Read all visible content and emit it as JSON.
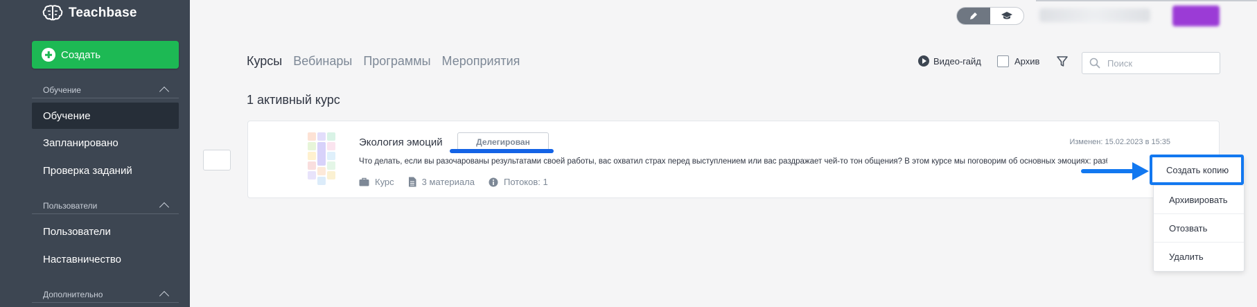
{
  "sidebar": {
    "brand": "Teachbase",
    "create_label": "Создать",
    "sections": [
      {
        "title": "Обучение",
        "items": [
          {
            "label": "Обучение",
            "active": true
          },
          {
            "label": "Запланировано"
          },
          {
            "label": "Проверка заданий"
          }
        ]
      },
      {
        "title": "Пользователи",
        "items": [
          {
            "label": "Пользователи"
          },
          {
            "label": "Наставничество"
          }
        ]
      },
      {
        "title": "Дополнительно",
        "items": []
      }
    ]
  },
  "topbar": {
    "mode_icons": [
      "pencil-icon",
      "graduation-cap-icon"
    ],
    "active_mode": "pencil",
    "user_name_blurred": true,
    "accent_button_color": "#9b3bd6"
  },
  "tabs": [
    "Курсы",
    "Вебинары",
    "Программы",
    "Мероприятия"
  ],
  "active_tab": "Курсы",
  "toolbar": {
    "video_guide": "Видео-гайд",
    "archive": "Архив",
    "search_placeholder": "Поиск"
  },
  "count_text": "1 активный курс",
  "course": {
    "title": "Экология эмоций",
    "badge": "Делегирован",
    "modified": "Изменен: 15.02.2023 в 15:35",
    "description": "Что делать, если вы разочарованы результатами своей работы, вас охватил страх перед выступлением или вас раздражает чей-то тон общения? В этом курсе мы поговорим об основных эмоциях: разберем, откуда",
    "type": "Курс",
    "materials": "3 материала",
    "streams": "Потоков: 1"
  },
  "menu": {
    "items": [
      "Создать копию",
      "Архивировать",
      "Отозвать",
      "Удалить"
    ],
    "highlighted": "Создать копию"
  },
  "colors": {
    "sidebar_bg": "#3d4652",
    "create_green": "#1db954",
    "annotation_blue": "#1278f0"
  }
}
